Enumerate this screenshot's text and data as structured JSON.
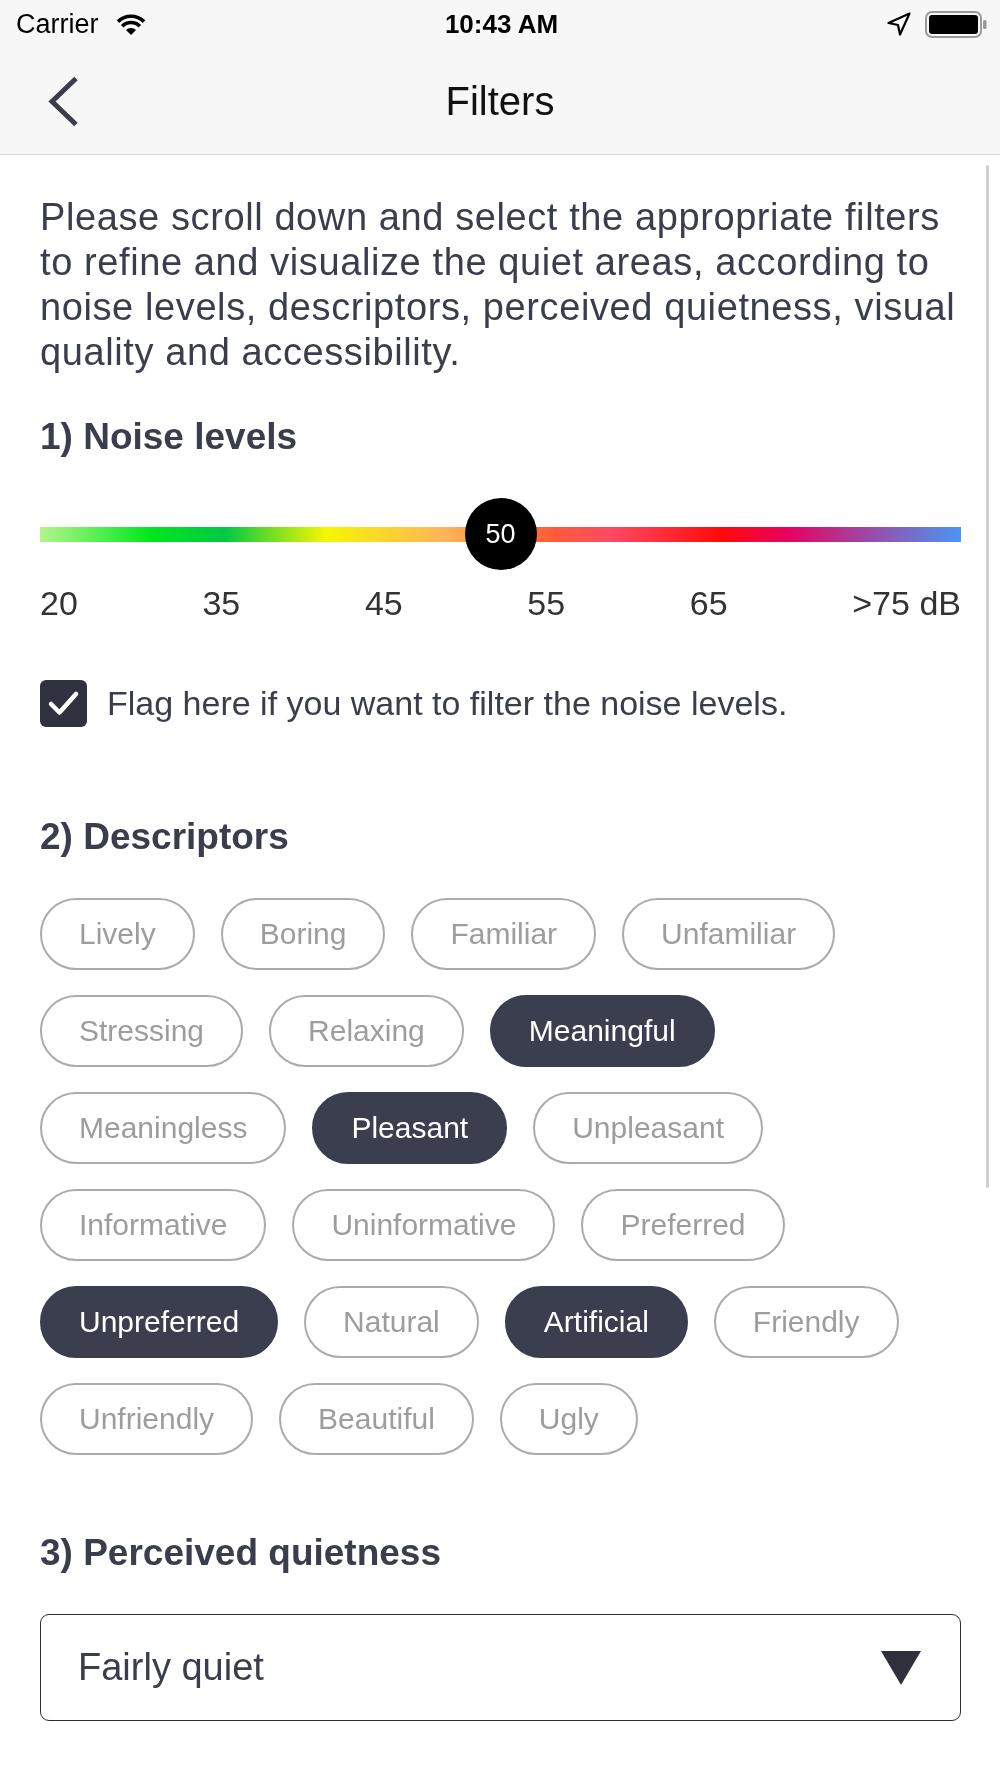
{
  "status_bar": {
    "carrier": "Carrier",
    "time": "10:43 AM"
  },
  "nav_bar": {
    "title": "Filters"
  },
  "intro": "Please scroll down and select the appropriate filters to refine and visualize the quiet areas, according to noise levels, descriptors, perceived quietness, visual quality and accessibility.",
  "noise_levels": {
    "heading": "1) Noise levels",
    "slider": {
      "value": "50",
      "level": 0.5
    },
    "scale_labels": [
      "20",
      "35",
      "45",
      "55",
      "65",
      ">75 dB"
    ],
    "filter_checkbox": {
      "label": "Flag here if you want to filter the noise levels.",
      "checked": true
    }
  },
  "descriptors": {
    "heading": "2) Descriptors",
    "chips": [
      {
        "label": "Lively",
        "selected": false
      },
      {
        "label": "Boring",
        "selected": false
      },
      {
        "label": "Familiar",
        "selected": false
      },
      {
        "label": "Unfamiliar",
        "selected": false
      },
      {
        "label": "Stressing",
        "selected": false
      },
      {
        "label": "Relaxing",
        "selected": false
      },
      {
        "label": "Meaningful",
        "selected": true
      },
      {
        "label": "Meaningless",
        "selected": false
      },
      {
        "label": "Pleasant",
        "selected": true
      },
      {
        "label": "Unpleasant",
        "selected": false
      },
      {
        "label": "Informative",
        "selected": false
      },
      {
        "label": "Uninformative",
        "selected": false
      },
      {
        "label": "Preferred",
        "selected": false
      },
      {
        "label": "Unpreferred",
        "selected": true
      },
      {
        "label": "Natural",
        "selected": false
      },
      {
        "label": "Artificial",
        "selected": true
      },
      {
        "label": "Friendly",
        "selected": false
      },
      {
        "label": "Unfriendly",
        "selected": false
      },
      {
        "label": "Beautiful",
        "selected": false
      },
      {
        "label": "Ugly",
        "selected": false
      }
    ]
  },
  "perceived_quietness": {
    "heading": "3) Perceived quietness",
    "dropdown": {
      "value": "Fairly quiet"
    }
  }
}
